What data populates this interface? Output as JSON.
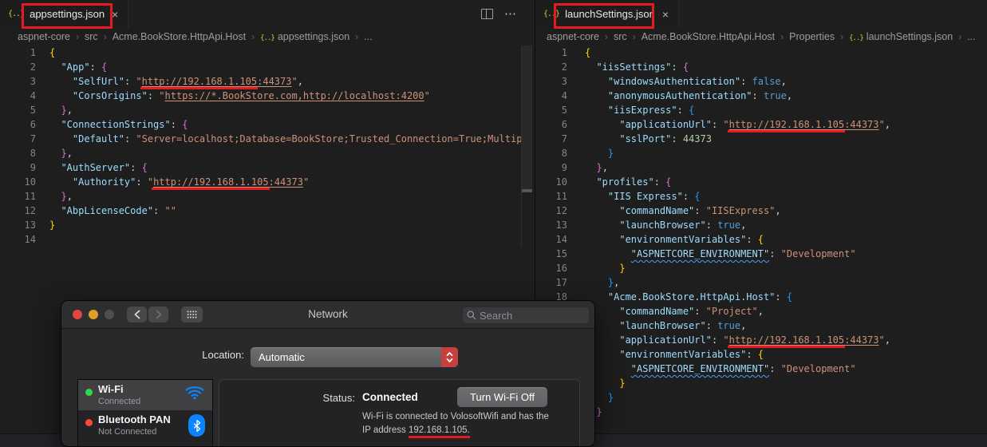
{
  "ui": {
    "crumb_sep": "›",
    "more": "⋯"
  },
  "colors": {
    "annotation_red": "#e31b22",
    "squiggle_blue": "#4a9df8",
    "bracket_level1": "#ffd700",
    "bracket_level2": "#da70d6",
    "bracket_level3": "#179fff",
    "json_key": "#9cdcfe",
    "json_string": "#ce9178",
    "json_bool": "#569cd6",
    "json_number": "#b5cea8",
    "mac_accent_blue": "#0a84ff",
    "popup_stepper_red": "#c6403d",
    "wifi_dot_green": "#32d74b",
    "bt_dot_red": "#ff453a"
  },
  "left_editor": {
    "tab_label": "appsettings.json",
    "tab_close": "×",
    "breadcrumb": [
      {
        "label": "aspnet-core"
      },
      {
        "label": "src"
      },
      {
        "label": "Acme.BookStore.HttpApi.Host"
      },
      {
        "label": "appsettings.json",
        "icon": "json"
      },
      {
        "label": "..."
      }
    ],
    "lines": [
      [
        [
          "g1",
          "{"
        ]
      ],
      [
        [
          "p",
          "  "
        ],
        [
          "k",
          "\"App\""
        ],
        [
          "p",
          ": "
        ],
        [
          "g2",
          "{"
        ]
      ],
      [
        [
          "p",
          "    "
        ],
        [
          "k",
          "\"SelfUrl\""
        ],
        [
          "p",
          ": "
        ],
        [
          "s",
          "\""
        ],
        [
          "r",
          "http://192.168.1.105"
        ],
        [
          "u",
          ":44373"
        ],
        [
          "s",
          "\""
        ],
        [
          "p",
          ","
        ]
      ],
      [
        [
          "p",
          "    "
        ],
        [
          "k",
          "\"CorsOrigins\""
        ],
        [
          "p",
          ": "
        ],
        [
          "s",
          "\""
        ],
        [
          "u",
          "https://*.BookStore.com,http://localhost:4200"
        ],
        [
          "s",
          "\""
        ]
      ],
      [
        [
          "p",
          "  "
        ],
        [
          "g2",
          "}"
        ],
        [
          "p",
          ","
        ]
      ],
      [
        [
          "p",
          "  "
        ],
        [
          "k",
          "\"ConnectionStrings\""
        ],
        [
          "p",
          ": "
        ],
        [
          "g2",
          "{"
        ]
      ],
      [
        [
          "p",
          "    "
        ],
        [
          "k",
          "\"Default\""
        ],
        [
          "p",
          ": "
        ],
        [
          "s",
          "\"Server=localhost;Database=BookStore;Trusted_Connection=True;Multipl"
        ]
      ],
      [
        [
          "p",
          "  "
        ],
        [
          "g2",
          "}"
        ],
        [
          "p",
          ","
        ]
      ],
      [
        [
          "p",
          "  "
        ],
        [
          "k",
          "\"AuthServer\""
        ],
        [
          "p",
          ": "
        ],
        [
          "g2",
          "{"
        ]
      ],
      [
        [
          "p",
          "    "
        ],
        [
          "k",
          "\"Authority\""
        ],
        [
          "p",
          ": "
        ],
        [
          "s",
          "\""
        ],
        [
          "r",
          "http://192.168.1.105"
        ],
        [
          "u",
          ":44373"
        ],
        [
          "s",
          "\""
        ]
      ],
      [
        [
          "p",
          "  "
        ],
        [
          "g2",
          "}"
        ],
        [
          "p",
          ","
        ]
      ],
      [
        [
          "p",
          "  "
        ],
        [
          "k",
          "\"AbpLicenseCode\""
        ],
        [
          "p",
          ": "
        ],
        [
          "s",
          "\"\""
        ]
      ],
      [
        [
          "g1",
          "}"
        ]
      ],
      []
    ]
  },
  "right_editor": {
    "tab_label": "launchSettings.json",
    "tab_close": "×",
    "breadcrumb": [
      {
        "label": "aspnet-core"
      },
      {
        "label": "src"
      },
      {
        "label": "Acme.BookStore.HttpApi.Host"
      },
      {
        "label": "Properties"
      },
      {
        "label": "launchSettings.json",
        "icon": "json"
      },
      {
        "label": "..."
      }
    ],
    "lines": [
      [
        [
          "g1",
          "{"
        ]
      ],
      [
        [
          "p",
          "  "
        ],
        [
          "k",
          "\"iisSettings\""
        ],
        [
          "p",
          ": "
        ],
        [
          "g2",
          "{"
        ]
      ],
      [
        [
          "p",
          "    "
        ],
        [
          "k",
          "\"windowsAuthentication\""
        ],
        [
          "p",
          ": "
        ],
        [
          "b",
          "false"
        ],
        [
          "p",
          ","
        ]
      ],
      [
        [
          "p",
          "    "
        ],
        [
          "k",
          "\"anonymousAuthentication\""
        ],
        [
          "p",
          ": "
        ],
        [
          "b",
          "true"
        ],
        [
          "p",
          ","
        ]
      ],
      [
        [
          "p",
          "    "
        ],
        [
          "k",
          "\"iisExpress\""
        ],
        [
          "p",
          ": "
        ],
        [
          "g3",
          "{"
        ]
      ],
      [
        [
          "p",
          "      "
        ],
        [
          "k",
          "\"applicationUrl\""
        ],
        [
          "p",
          ": "
        ],
        [
          "s",
          "\""
        ],
        [
          "r",
          "http://192.168.1.105"
        ],
        [
          "u",
          ":44373"
        ],
        [
          "s",
          "\""
        ],
        [
          "p",
          ","
        ]
      ],
      [
        [
          "p",
          "      "
        ],
        [
          "k",
          "\"sslPort\""
        ],
        [
          "p",
          ": "
        ],
        [
          "n",
          "44373"
        ]
      ],
      [
        [
          "p",
          "    "
        ],
        [
          "g3",
          "}"
        ]
      ],
      [
        [
          "p",
          "  "
        ],
        [
          "g2",
          "}"
        ],
        [
          "p",
          ","
        ]
      ],
      [
        [
          "p",
          "  "
        ],
        [
          "k",
          "\"profiles\""
        ],
        [
          "p",
          ": "
        ],
        [
          "g2",
          "{"
        ]
      ],
      [
        [
          "p",
          "    "
        ],
        [
          "k",
          "\"IIS Express\""
        ],
        [
          "p",
          ": "
        ],
        [
          "g3",
          "{"
        ]
      ],
      [
        [
          "p",
          "      "
        ],
        [
          "k",
          "\"commandName\""
        ],
        [
          "p",
          ": "
        ],
        [
          "s",
          "\"IISExpress\""
        ],
        [
          "p",
          ","
        ]
      ],
      [
        [
          "p",
          "      "
        ],
        [
          "k",
          "\"launchBrowser\""
        ],
        [
          "p",
          ": "
        ],
        [
          "b",
          "true"
        ],
        [
          "p",
          ","
        ]
      ],
      [
        [
          "p",
          "      "
        ],
        [
          "k",
          "\"environmentVariables\""
        ],
        [
          "p",
          ": "
        ],
        [
          "g1",
          "{"
        ]
      ],
      [
        [
          "p",
          "        "
        ],
        [
          "q",
          "\"ASPNETCORE_ENVIRONMENT\""
        ],
        [
          "p",
          ": "
        ],
        [
          "s",
          "\"Development\""
        ]
      ],
      [
        [
          "p",
          "      "
        ],
        [
          "g1",
          "}"
        ]
      ],
      [
        [
          "p",
          "    "
        ],
        [
          "g3",
          "}"
        ],
        [
          "p",
          ","
        ]
      ],
      [
        [
          "p",
          "    "
        ],
        [
          "k",
          "\"Acme.BookStore.HttpApi.Host\""
        ],
        [
          "p",
          ": "
        ],
        [
          "g3",
          "{"
        ]
      ],
      [
        [
          "p",
          "      "
        ],
        [
          "k",
          "\"commandName\""
        ],
        [
          "p",
          ": "
        ],
        [
          "s",
          "\"Project\""
        ],
        [
          "p",
          ","
        ]
      ],
      [
        [
          "p",
          "      "
        ],
        [
          "k",
          "\"launchBrowser\""
        ],
        [
          "p",
          ": "
        ],
        [
          "b",
          "true"
        ],
        [
          "p",
          ","
        ]
      ],
      [
        [
          "p",
          "      "
        ],
        [
          "k",
          "\"applicationUrl\""
        ],
        [
          "p",
          ": "
        ],
        [
          "s",
          "\""
        ],
        [
          "r",
          "http://192.168.1.105"
        ],
        [
          "u",
          ":44373"
        ],
        [
          "s",
          "\""
        ],
        [
          "p",
          ","
        ]
      ],
      [
        [
          "p",
          "      "
        ],
        [
          "k",
          "\"environmentVariables\""
        ],
        [
          "p",
          ": "
        ],
        [
          "g1",
          "{"
        ]
      ],
      [
        [
          "p",
          "        "
        ],
        [
          "q",
          "\"ASPNETCORE_ENVIRONMENT\""
        ],
        [
          "p",
          ": "
        ],
        [
          "s",
          "\"Development\""
        ]
      ],
      [
        [
          "p",
          "      "
        ],
        [
          "g1",
          "}"
        ]
      ],
      [
        [
          "p",
          "    "
        ],
        [
          "g3",
          "}"
        ]
      ],
      [
        [
          "p",
          "  "
        ],
        [
          "g2",
          "}"
        ]
      ]
    ]
  },
  "network": {
    "title": "Network",
    "search_placeholder": "Search",
    "location_label": "Location:",
    "location_value": "Automatic",
    "services": [
      {
        "name": "Wi-Fi",
        "status": "Connected",
        "icon": "wifi-icon",
        "dot": "#32d74b",
        "selected": true
      },
      {
        "name": "Bluetooth PAN",
        "status": "Not Connected",
        "icon": "bluetooth-icon",
        "dot": "#ff453a",
        "selected": false
      }
    ],
    "panel": {
      "status_label": "Status:",
      "status_value": "Connected",
      "button_label": "Turn Wi-Fi Off",
      "desc_line1": "Wi-Fi is connected to VolosoftWifi and has the",
      "desc_prefix": "IP address ",
      "desc_ip": "192.168.1.105."
    }
  }
}
